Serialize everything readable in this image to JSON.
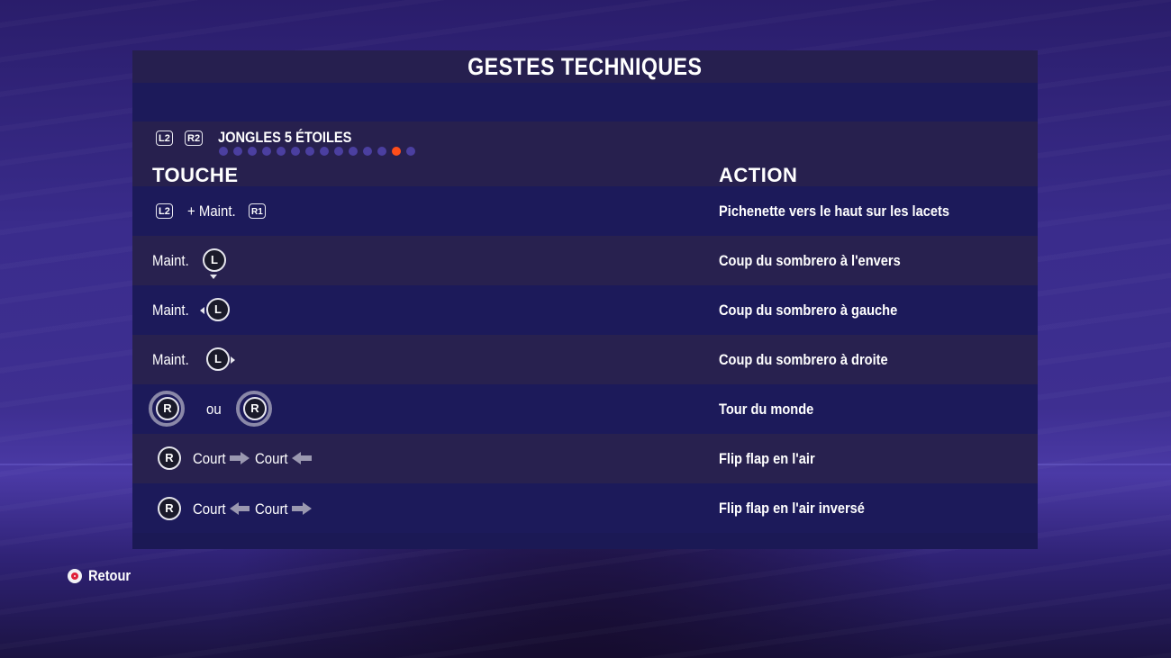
{
  "page": {
    "title": "GESTES TECHNIQUES",
    "back_label": "Retour"
  },
  "category": {
    "buttons": [
      "L2",
      "R2"
    ],
    "title": "JONGLES 5 ÉTOILES",
    "page_dots_total": 14,
    "page_dots_active_index": 12
  },
  "columns": {
    "touche": "TOUCHE",
    "action": "ACTION"
  },
  "rows": [
    {
      "input_button_1": "L2",
      "input_text": "+ Maint.",
      "input_button_2": "R1",
      "action": "Pichenette vers le haut sur les lacets"
    },
    {
      "input_text": "Maint.",
      "stick": "L",
      "direction": "down",
      "action": "Coup du sombrero à l'envers"
    },
    {
      "input_text": "Maint.",
      "stick": "L",
      "direction": "left",
      "action": "Coup du sombrero à gauche"
    },
    {
      "input_text": "Maint.",
      "stick": "L",
      "direction": "right",
      "action": "Coup du sombrero à droite"
    },
    {
      "stick_1": "R",
      "input_text": "ou",
      "stick_2": "R",
      "action": "Tour du monde"
    },
    {
      "stick": "R",
      "input_text_1": "Court",
      "input_text_2": "Court",
      "action": "Flip flap en l'air"
    },
    {
      "stick": "R",
      "input_text_1": "Court",
      "input_text_2": "Court",
      "action": "Flip flap en l'air inversé"
    }
  ],
  "colors": {
    "active_dot": "#ff4d1a",
    "inactive_dot": "#4b3fa0",
    "back_button_ring": "#e0213a"
  }
}
